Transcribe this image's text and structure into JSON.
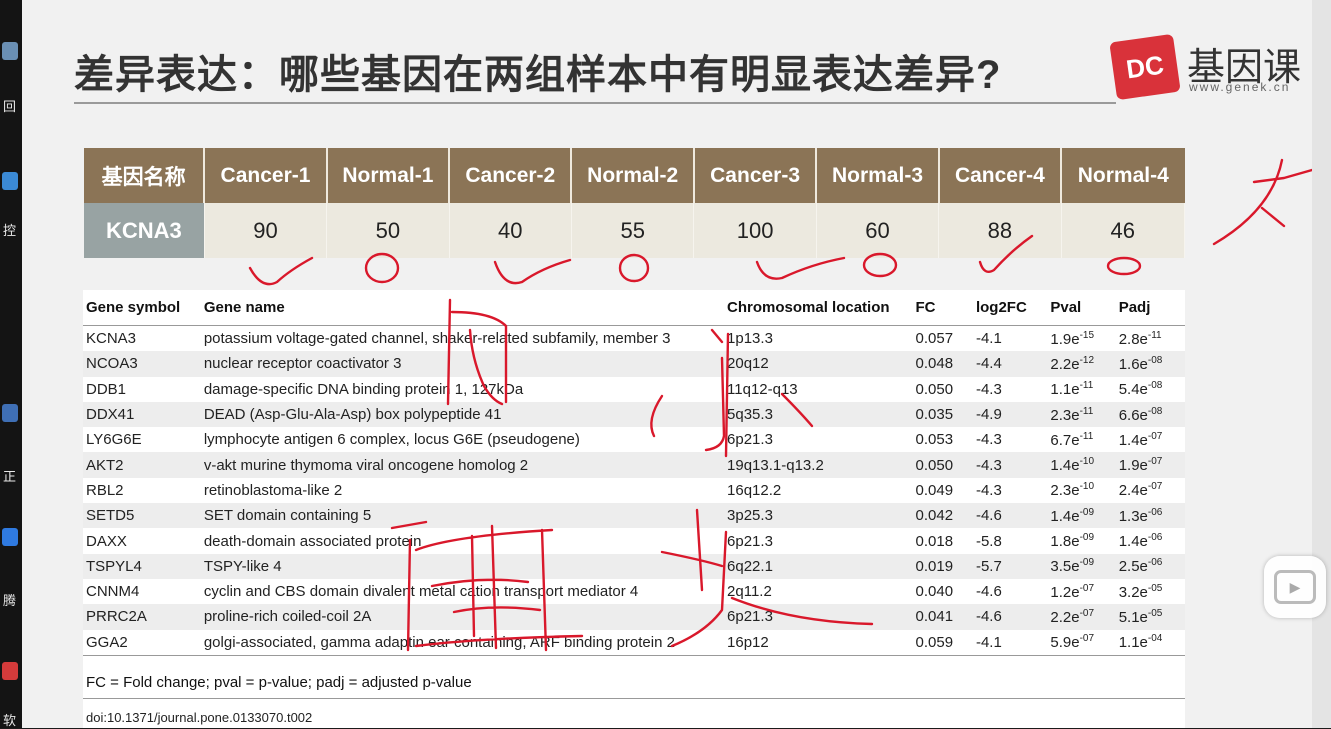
{
  "slide": {
    "title": "差异表达：哪些基因在两组样本中有明显表达差异?",
    "logo": {
      "badge": "DC",
      "name": "基因课",
      "url": "www.genek.cn"
    }
  },
  "expression_table": {
    "headers": [
      "基因名称",
      "Cancer-1",
      "Normal-1",
      "Cancer-2",
      "Normal-2",
      "Cancer-3",
      "Normal-3",
      "Cancer-4",
      "Normal-4"
    ],
    "gene": "KCNA3",
    "values": [
      "90",
      "50",
      "40",
      "55",
      "100",
      "60",
      "88",
      "46"
    ]
  },
  "gene_table": {
    "headers": {
      "symbol": "Gene symbol",
      "name": "Gene name",
      "location": "Chromosomal location",
      "fc": "FC",
      "log2fc": "log2FC",
      "pval": "Pval",
      "padj": "Padj"
    },
    "rows": [
      {
        "symbol": "KCNA3",
        "name": "potassium voltage-gated channel, shaker-related subfamily, member 3",
        "location": "1p13.3",
        "fc": "0.057",
        "log2fc": "-4.1",
        "pval_base": "1.9e",
        "pval_exp": "-15",
        "padj_base": "2.8e",
        "padj_exp": "-11"
      },
      {
        "symbol": "NCOA3",
        "name": "nuclear receptor coactivator 3",
        "location": "20q12",
        "fc": "0.048",
        "log2fc": "-4.4",
        "pval_base": "2.2e",
        "pval_exp": "-12",
        "padj_base": "1.6e",
        "padj_exp": "-08"
      },
      {
        "symbol": "DDB1",
        "name": "damage-specific DNA binding protein 1, 127kDa",
        "location": "11q12-q13",
        "fc": "0.050",
        "log2fc": "-4.3",
        "pval_base": "1.1e",
        "pval_exp": "-11",
        "padj_base": "5.4e",
        "padj_exp": "-08"
      },
      {
        "symbol": "DDX41",
        "name": "DEAD (Asp-Glu-Ala-Asp) box polypeptide 41",
        "location": "5q35.3",
        "fc": "0.035",
        "log2fc": "-4.9",
        "pval_base": "2.3e",
        "pval_exp": "-11",
        "padj_base": "6.6e",
        "padj_exp": "-08"
      },
      {
        "symbol": "LY6G6E",
        "name": "lymphocyte antigen 6 complex, locus G6E (pseudogene)",
        "location": "6p21.3",
        "fc": "0.053",
        "log2fc": "-4.3",
        "pval_base": "6.7e",
        "pval_exp": "-11",
        "padj_base": "1.4e",
        "padj_exp": "-07"
      },
      {
        "symbol": "AKT2",
        "name": "v-akt murine thymoma viral oncogene homolog 2",
        "location": "19q13.1-q13.2",
        "fc": "0.050",
        "log2fc": "-4.3",
        "pval_base": "1.4e",
        "pval_exp": "-10",
        "padj_base": "1.9e",
        "padj_exp": "-07"
      },
      {
        "symbol": "RBL2",
        "name": "retinoblastoma-like 2",
        "location": "16q12.2",
        "fc": "0.049",
        "log2fc": "-4.3",
        "pval_base": "2.3e",
        "pval_exp": "-10",
        "padj_base": "2.4e",
        "padj_exp": "-07"
      },
      {
        "symbol": "SETD5",
        "name": "SET domain containing 5",
        "location": "3p25.3",
        "fc": "0.042",
        "log2fc": "-4.6",
        "pval_base": "1.4e",
        "pval_exp": "-09",
        "padj_base": "1.3e",
        "padj_exp": "-06"
      },
      {
        "symbol": "DAXX",
        "name": "death-domain associated protein",
        "location": "6p21.3",
        "fc": "0.018",
        "log2fc": "-5.8",
        "pval_base": "1.8e",
        "pval_exp": "-09",
        "padj_base": "1.4e",
        "padj_exp": "-06"
      },
      {
        "symbol": "TSPYL4",
        "name": "TSPY-like 4",
        "location": "6q22.1",
        "fc": "0.019",
        "log2fc": "-5.7",
        "pval_base": "3.5e",
        "pval_exp": "-09",
        "padj_base": "2.5e",
        "padj_exp": "-06"
      },
      {
        "symbol": "CNNM4",
        "name": "cyclin and CBS domain divalent metal cation transport mediator 4",
        "location": "2q11.2",
        "fc": "0.040",
        "log2fc": "-4.6",
        "pval_base": "1.2e",
        "pval_exp": "-07",
        "padj_base": "3.2e",
        "padj_exp": "-05"
      },
      {
        "symbol": "PRRC2A",
        "name": "proline-rich coiled-coil 2A",
        "location": "6p21.3",
        "fc": "0.041",
        "log2fc": "-4.6",
        "pval_base": "2.2e",
        "pval_exp": "-07",
        "padj_base": "5.1e",
        "padj_exp": "-05"
      },
      {
        "symbol": "GGA2",
        "name": "golgi-associated, gamma adaptin ear containing, ARF binding protein 2",
        "location": "16p12",
        "fc": "0.059",
        "log2fc": "-4.1",
        "pval_base": "5.9e",
        "pval_exp": "-07",
        "padj_base": "1.1e",
        "padj_exp": "-04"
      }
    ],
    "footnote": "FC = Fold change; pval = p-value; padj = adjusted p-value",
    "doi": "doi:10.1371/journal.pone.0133070.t002"
  },
  "desktop": {
    "labels": [
      "回",
      "控",
      "正",
      "腾",
      "软"
    ],
    "icon_colors": [
      "#6a8fb3",
      "#3b8ad6",
      "#3f6fb5",
      "#2f7ae0",
      "#d43b3b"
    ]
  },
  "colors": {
    "ink": "#d9182b",
    "header_brown": "#8b7456",
    "gene_cell": "#98a3a3"
  },
  "player": {
    "icon": "bilibili-tv-icon"
  }
}
